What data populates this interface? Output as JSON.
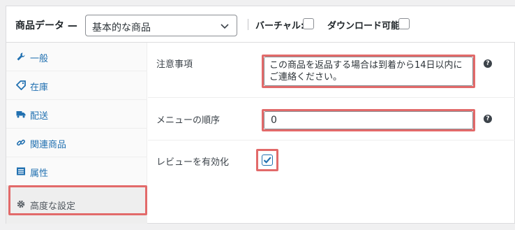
{
  "header": {
    "title": "商品データ —",
    "product_type": {
      "selected": "基本的な商品"
    },
    "virtual_label": "バーチャル:",
    "virtual_checked": false,
    "downloadable_label": "ダウンロード可能:",
    "downloadable_checked": false
  },
  "sidebar": {
    "items": [
      {
        "label": "一般",
        "icon": "wrench-icon"
      },
      {
        "label": "在庫",
        "icon": "tag-icon"
      },
      {
        "label": "配送",
        "icon": "truck-icon"
      },
      {
        "label": "関連商品",
        "icon": "link-icon"
      },
      {
        "label": "属性",
        "icon": "list-icon"
      },
      {
        "label": "高度な設定",
        "icon": "gear-icon",
        "active": true
      }
    ]
  },
  "advanced": {
    "purchase_note_label": "注意事項",
    "purchase_note_value": "この商品を返品する場合は到着から14日以内にご連絡ください。",
    "menu_order_label": "メニューの順序",
    "menu_order_value": "0",
    "enable_reviews_label": "レビューを有効化",
    "enable_reviews_checked": true
  },
  "colors": {
    "highlight": "#e26a6a",
    "link": "#2271b1"
  }
}
